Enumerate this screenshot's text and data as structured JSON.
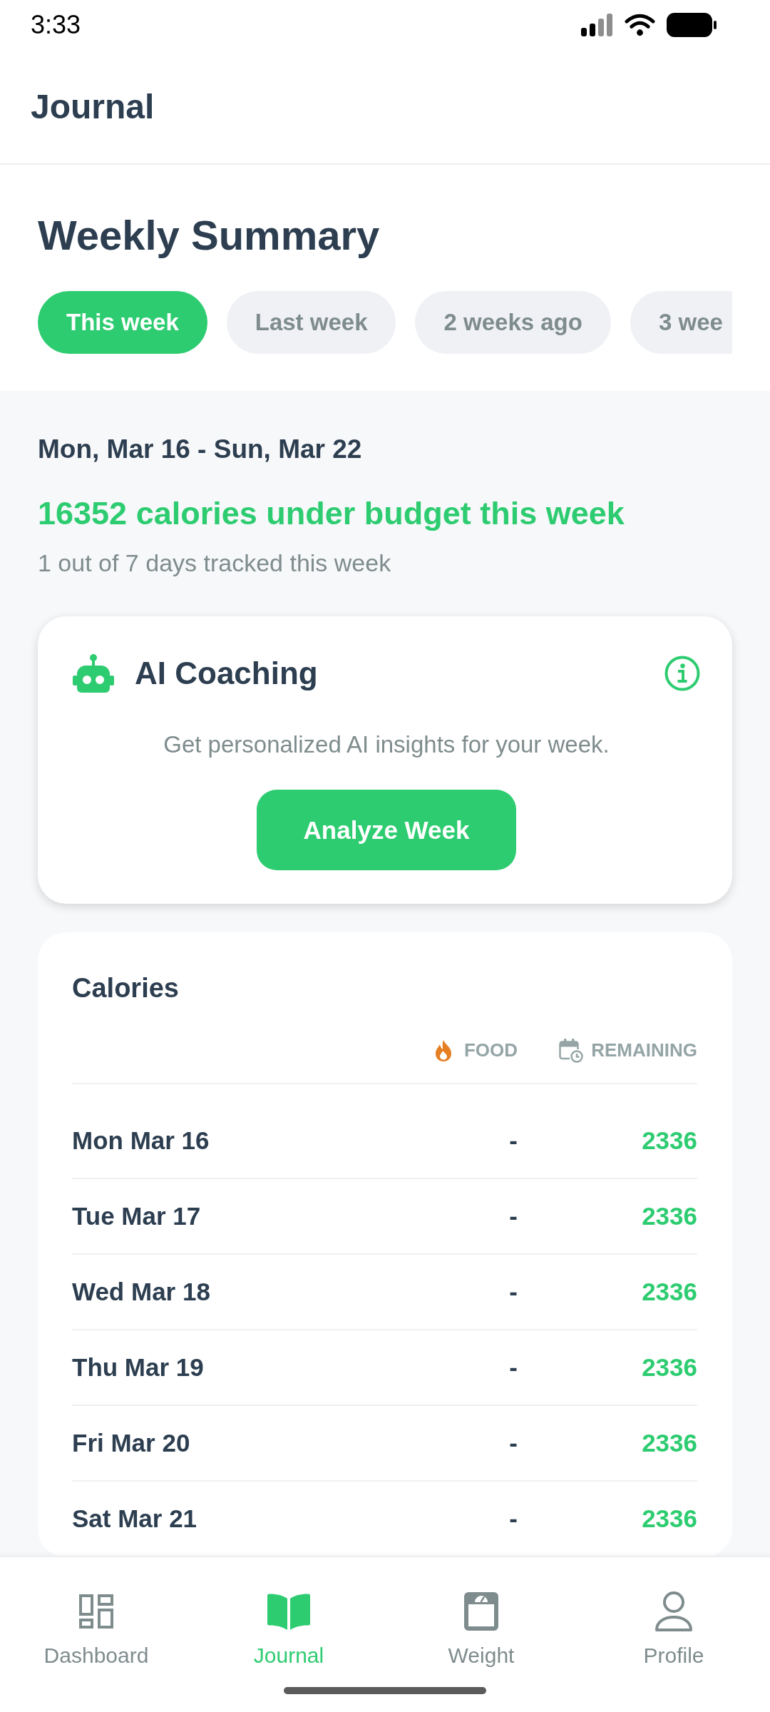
{
  "status_bar": {
    "time": "3:33"
  },
  "header": {
    "title": "Journal"
  },
  "summary": {
    "title": "Weekly Summary",
    "tabs": [
      {
        "label": "This week",
        "selected": true
      },
      {
        "label": "Last week",
        "selected": false
      },
      {
        "label": "2 weeks ago",
        "selected": false
      },
      {
        "label": "3 wee",
        "selected": false
      }
    ]
  },
  "week": {
    "range": "Mon, Mar 16 - Sun, Mar 22",
    "headline": "16352 calories under budget this week",
    "tracked": "1 out of 7 days tracked this week"
  },
  "ai_coaching": {
    "title": "AI Coaching",
    "description": "Get personalized AI insights for your week.",
    "button": "Analyze Week"
  },
  "calories": {
    "title": "Calories",
    "columns": [
      "FOOD",
      "REMAINING"
    ],
    "rows": [
      {
        "day": "Mon Mar 16",
        "food": "-",
        "remaining": "2336"
      },
      {
        "day": "Tue Mar 17",
        "food": "-",
        "remaining": "2336"
      },
      {
        "day": "Wed Mar 18",
        "food": "-",
        "remaining": "2336"
      },
      {
        "day": "Thu Mar 19",
        "food": "-",
        "remaining": "2336"
      },
      {
        "day": "Fri Mar 20",
        "food": "-",
        "remaining": "2336"
      },
      {
        "day": "Sat Mar 21",
        "food": "-",
        "remaining": "2336"
      }
    ]
  },
  "bottom_nav": [
    {
      "label": "Dashboard",
      "selected": false
    },
    {
      "label": "Journal",
      "selected": true
    },
    {
      "label": "Weight",
      "selected": false
    },
    {
      "label": "Profile",
      "selected": false
    }
  ]
}
